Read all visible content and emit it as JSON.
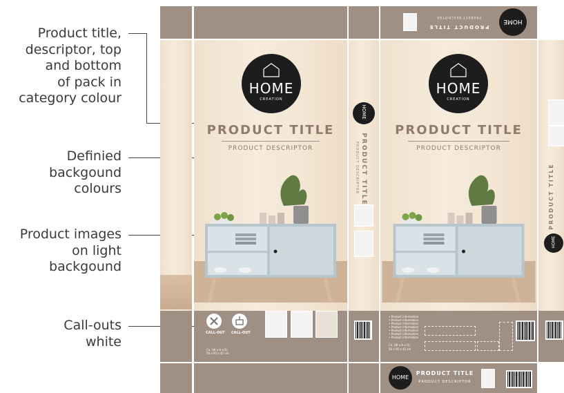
{
  "annotations": [
    {
      "lines": [
        "Product title,",
        "descriptor, top",
        "and bottom",
        "of pack in",
        "category colour"
      ]
    },
    {
      "lines": [
        "Definied",
        "backgound",
        "colours"
      ]
    },
    {
      "lines": [
        "Product images",
        "on light",
        "backgound"
      ]
    },
    {
      "lines": [
        "Call-outs",
        "white"
      ]
    }
  ],
  "brand": {
    "name": "HOME",
    "sub": "CREATION"
  },
  "pack": {
    "title": "PRODUCT TITLE",
    "descriptor": "PRODUCT DESCRIPTOR",
    "callout_label": "CALL-OUT",
    "dims_line1": "Ca. (W x H x D)",
    "dims_line2": "50 x 95 x 42 cm",
    "info_lines": [
      "• Product information",
      "• Product information",
      "• Product information",
      "• Product information",
      "• Product information",
      "• Product information",
      "• Product information"
    ]
  },
  "colors": {
    "category": "#a08f83",
    "logo": "#1d1d1d",
    "title": "#8f7b6c",
    "background": "#f3e6d4"
  }
}
